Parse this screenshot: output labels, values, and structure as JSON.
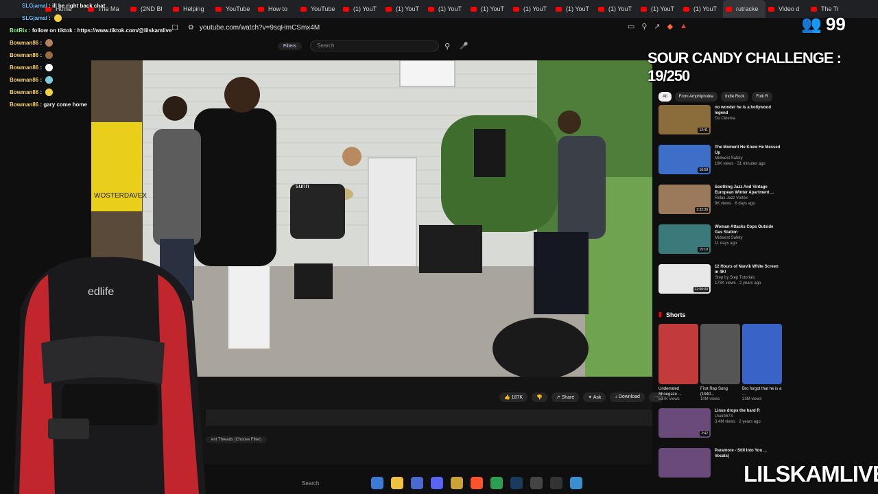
{
  "browser": {
    "tabs": [
      {
        "label": "Home"
      },
      {
        "label": "The Ma"
      },
      {
        "label": "(2ND Bl"
      },
      {
        "label": "Helping"
      },
      {
        "label": "YouTube"
      },
      {
        "label": "How to"
      },
      {
        "label": "YouTube"
      },
      {
        "label": "(1) YouT"
      },
      {
        "label": "(1) YouT"
      },
      {
        "label": "(1) YouT"
      },
      {
        "label": "(1) YouT"
      },
      {
        "label": "(1) YouT"
      },
      {
        "label": "(1) YouT"
      },
      {
        "label": "(1) YouT"
      },
      {
        "label": "(1) YouT"
      },
      {
        "label": "(1) YouT"
      },
      {
        "label": "rutracke"
      },
      {
        "label": "Video d"
      },
      {
        "label": "The Tr"
      }
    ],
    "url": "youtube.com/watch?v=9sqHmCSmx4M"
  },
  "youtube": {
    "filters_label": "Filters",
    "search_placeholder": "Search",
    "video_scene_text": {
      "drum_head": "sunn",
      "banner": "WOSTERDAVEX",
      "chair_brand": "edlife"
    },
    "actions": {
      "likes": "187K",
      "share": "Share",
      "ask": "Ask",
      "download": "Download"
    },
    "threads_filter": "ent Threads (Choose Filter)",
    "chips": [
      "All",
      "From Amphiphobia",
      "Indie Rock",
      "Folk R"
    ],
    "recommendations": [
      {
        "title": "no wonder he is a hollywood legend",
        "channel": "Du Cinema",
        "duration": "12:41",
        "color": "#8a6d3b"
      },
      {
        "title": "The Moment He Knew He Messed Up",
        "channel": "Midwest Safety",
        "meta": "19K views · 31 minutes ago",
        "duration": "16:58",
        "color": "#3d6fc8"
      },
      {
        "title": "Soothing Jazz And Vintage European Winter Apartment ...",
        "channel": "Relax Jazz Vortex",
        "meta": "9K views · 6 days ago",
        "duration": "3:32:36",
        "color": "#9a7a5a"
      },
      {
        "title": "Woman Attacks Cops Outside Gas Station",
        "channel": "Midwest Safety",
        "meta": "11 days ago",
        "duration": "15:19",
        "color": "#3a7a7a"
      },
      {
        "title": "12 Hours of Narvik White Screen in 4K!",
        "channel": "Step by Step Tutorials",
        "meta": "173K views · 2 years ago",
        "duration": "12:00:00",
        "color": "#e8e8e8"
      }
    ],
    "shorts_label": "Shorts",
    "shorts": [
      {
        "title": "Underrated Shoegaze ...",
        "views": "537K views",
        "color": "#c23b3b"
      },
      {
        "title": "First Rap Song (1940...",
        "views": "10M views",
        "color": "#555555"
      },
      {
        "title": "Bro forgot that he is a ...",
        "views": "23M views",
        "color": "#3a63c8"
      }
    ],
    "more_recs": [
      {
        "title": "Linus drops the hard R",
        "channel": "User4673",
        "meta": "3.4M views · 2 years ago",
        "duration": "2:42"
      },
      {
        "title": "Paramore - Still Into You ... Vocals)",
        "channel": "",
        "meta": "",
        "duration": ""
      }
    ]
  },
  "chat": [
    {
      "user": "SLGjamal",
      "text": "ill be right back chat",
      "cls": "user2"
    },
    {
      "user": "SLGjamal",
      "text": "",
      "cls": "user2"
    },
    {
      "user": "BotRix",
      "text": "follow on tiktok : https://www.tiktok.com/@lilskamlive",
      "cls": "bot"
    },
    {
      "user": "Bowman86",
      "text": "",
      "cls": "user"
    },
    {
      "user": "Bowman86",
      "text": "",
      "cls": "user"
    },
    {
      "user": "Bowman86",
      "text": "",
      "cls": "user"
    },
    {
      "user": "Bowman86",
      "text": "",
      "cls": "user"
    },
    {
      "user": "Bowman86",
      "text": "",
      "cls": "user"
    },
    {
      "user": "Bowman86",
      "text": "gary come home",
      "cls": "user"
    }
  ],
  "overlay": {
    "challenge": "SOUR CANDY CHALLENGE : 19/250",
    "viewer_count": "99",
    "brand": "LILSKAMLIVE"
  },
  "taskbar": {
    "search_placeholder": "Search"
  }
}
